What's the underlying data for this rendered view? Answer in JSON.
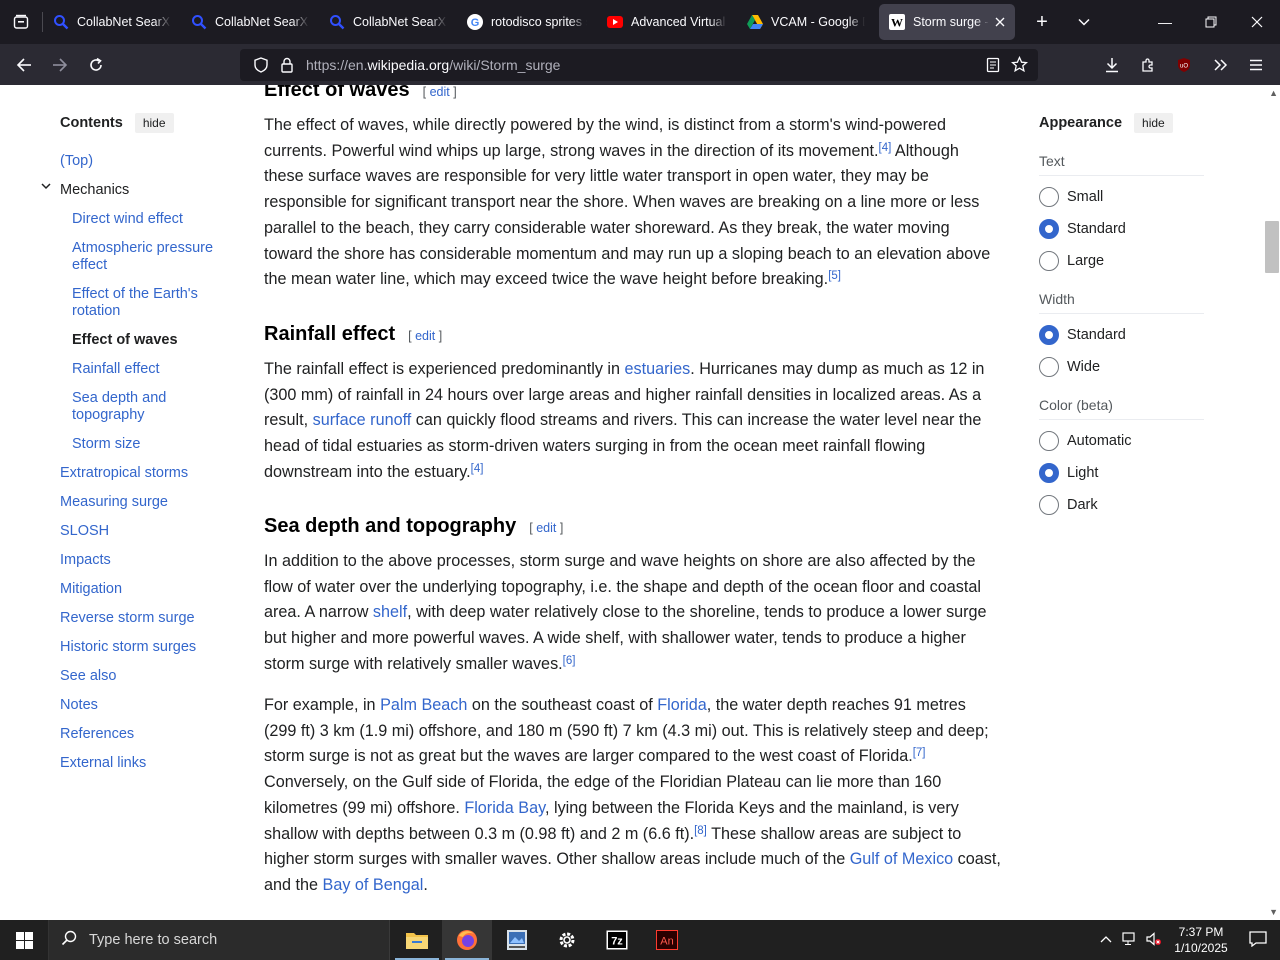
{
  "browser": {
    "tabs": [
      {
        "title": "CollabNet SearXNG",
        "icon": "searxng-icon",
        "active": false
      },
      {
        "title": "CollabNet SearXNG",
        "icon": "searxng-icon",
        "active": false
      },
      {
        "title": "CollabNet SearXNG",
        "icon": "searxng-icon",
        "active": false
      },
      {
        "title": "rotodisco sprites s",
        "icon": "google-icon",
        "active": false
      },
      {
        "title": "Advanced Virtual C",
        "icon": "youtube-icon",
        "active": false
      },
      {
        "title": "VCAM - Google Dri",
        "icon": "google-drive-icon",
        "active": false
      },
      {
        "title": "Storm surge - Wiki",
        "icon": "wikipedia-icon",
        "active": true
      }
    ],
    "url_prefix": "https://en.",
    "url_domain": "wikipedia.org",
    "url_path": "/wiki/Storm_surge"
  },
  "toc": {
    "title": "Contents",
    "hide_label": "hide",
    "items": [
      {
        "label": "(Top)",
        "level": 1
      },
      {
        "label": "Mechanics",
        "level": 1,
        "expanded": true
      },
      {
        "label": "Direct wind effect",
        "level": 2
      },
      {
        "label": "Atmospheric pressure effect",
        "level": 2
      },
      {
        "label": "Effect of the Earth's rotation",
        "level": 2
      },
      {
        "label": "Effect of waves",
        "level": 2,
        "current": true
      },
      {
        "label": "Rainfall effect",
        "level": 2
      },
      {
        "label": "Sea depth and topography",
        "level": 2
      },
      {
        "label": "Storm size",
        "level": 2
      },
      {
        "label": "Extratropical storms",
        "level": 1
      },
      {
        "label": "Measuring surge",
        "level": 1
      },
      {
        "label": "SLOSH",
        "level": 1
      },
      {
        "label": "Impacts",
        "level": 1
      },
      {
        "label": "Mitigation",
        "level": 1
      },
      {
        "label": "Reverse storm surge",
        "level": 1
      },
      {
        "label": "Historic storm surges",
        "level": 1
      },
      {
        "label": "See also",
        "level": 1
      },
      {
        "label": "Notes",
        "level": 1
      },
      {
        "label": "References",
        "level": 1
      },
      {
        "label": "External links",
        "level": 1
      }
    ]
  },
  "article": {
    "edit_label": "edit",
    "sections": [
      {
        "heading": "Effect of waves",
        "paragraphs": [
          [
            {
              "t": "The effect of waves, while directly powered by the wind, is distinct from a storm's wind-powered currents. Powerful wind whips up large, strong waves in the direction of its movement."
            },
            {
              "sup": "[4]"
            },
            {
              "t": " Although these surface waves are responsible for very little water transport in open water, they may be responsible for significant transport near the shore. When waves are breaking on a line more or less parallel to the beach, they carry considerable water shoreward. As they break, the water moving toward the shore has considerable momentum and may run up a sloping beach to an elevation above the mean water line, which may exceed twice the wave height before breaking."
            },
            {
              "sup": "[5]"
            }
          ]
        ]
      },
      {
        "heading": "Rainfall effect",
        "paragraphs": [
          [
            {
              "t": "The rainfall effect is experienced predominantly in "
            },
            {
              "a": "estuaries"
            },
            {
              "t": ". Hurricanes may dump as much as 12 in (300 mm) of rainfall in 24 hours over large areas and higher rainfall densities in localized areas. As a result, "
            },
            {
              "a": "surface runoff"
            },
            {
              "t": " can quickly flood streams and rivers. This can increase the water level near the head of tidal estuaries as storm-driven waters surging in from the ocean meet rainfall flowing downstream into the estuary."
            },
            {
              "sup": "[4]"
            }
          ]
        ]
      },
      {
        "heading": "Sea depth and topography",
        "paragraphs": [
          [
            {
              "t": "In addition to the above processes, storm surge and wave heights on shore are also affected by the flow of water over the underlying topography, i.e. the shape and depth of the ocean floor and coastal area. A narrow "
            },
            {
              "a": "shelf"
            },
            {
              "t": ", with deep water relatively close to the shoreline, tends to produce a lower surge but higher and more powerful waves. A wide shelf, with shallower water, tends to produce a higher storm surge with relatively smaller waves."
            },
            {
              "sup": "[6]"
            }
          ],
          [
            {
              "t": "For example, in "
            },
            {
              "a": "Palm Beach"
            },
            {
              "t": " on the southeast coast of "
            },
            {
              "a": "Florida"
            },
            {
              "t": ", the water depth reaches 91 metres (299 ft) 3 km (1.9 mi) offshore, and 180 m (590 ft) 7 km (4.3 mi) out. This is relatively steep and deep; storm surge is not as great but the waves are larger compared to the west coast of Florida."
            },
            {
              "sup": "[7]"
            },
            {
              "t": " Conversely, on the Gulf side of Florida, the edge of the Floridian Plateau can lie more than 160 kilometres (99 mi) offshore. "
            },
            {
              "a": "Florida Bay"
            },
            {
              "t": ", lying between the Florida Keys and the mainland, is very shallow with depths between 0.3 m (0.98 ft) and 2 m (6.6 ft)."
            },
            {
              "sup": "[8]"
            },
            {
              "t": " These shallow areas are subject to higher storm surges with smaller waves. Other shallow areas include much of the "
            },
            {
              "a": "Gulf of Mexico"
            },
            {
              "t": " coast, and the "
            },
            {
              "a": "Bay of Bengal"
            },
            {
              "t": "."
            }
          ]
        ]
      }
    ]
  },
  "appearance": {
    "title": "Appearance",
    "hide_label": "hide",
    "groups": [
      {
        "label": "Text",
        "options": [
          "Small",
          "Standard",
          "Large"
        ],
        "selected": "Standard"
      },
      {
        "label": "Width",
        "options": [
          "Standard",
          "Wide"
        ],
        "selected": "Standard"
      },
      {
        "label": "Color (beta)",
        "options": [
          "Automatic",
          "Light",
          "Dark"
        ],
        "selected": "Light"
      }
    ]
  },
  "taskbar": {
    "search_placeholder": "Type here to search",
    "time": "7:37 PM",
    "date": "1/10/2025"
  },
  "colors": {
    "link": "#3366cc",
    "text": "#202122",
    "chrome_dark": "#1c1b22",
    "toolbar": "#2b2a33"
  }
}
